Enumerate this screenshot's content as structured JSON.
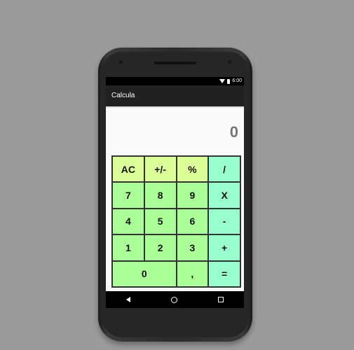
{
  "statusbar": {
    "time": "6:00",
    "wifi_icon": "wifi-icon",
    "battery_icon": "battery-icon"
  },
  "app": {
    "title": "Calcula"
  },
  "display": {
    "value": "0"
  },
  "keypad": {
    "keys": [
      {
        "label": "AC",
        "type": "top"
      },
      {
        "label": "+/-",
        "type": "top"
      },
      {
        "label": "%",
        "type": "top"
      },
      {
        "label": "/",
        "type": "op"
      },
      {
        "label": "7",
        "type": "num"
      },
      {
        "label": "8",
        "type": "num"
      },
      {
        "label": "9",
        "type": "num"
      },
      {
        "label": "X",
        "type": "op"
      },
      {
        "label": "4",
        "type": "num"
      },
      {
        "label": "5",
        "type": "num"
      },
      {
        "label": "6",
        "type": "num"
      },
      {
        "label": "-",
        "type": "op"
      },
      {
        "label": "1",
        "type": "num"
      },
      {
        "label": "2",
        "type": "num"
      },
      {
        "label": "3",
        "type": "num"
      },
      {
        "label": "+",
        "type": "op"
      },
      {
        "label": "0",
        "type": "num"
      },
      {
        "label": ",",
        "type": "num"
      },
      {
        "label": "=",
        "type": "op"
      }
    ]
  },
  "navbar": {
    "back_icon": "back-icon",
    "home_icon": "home-icon",
    "recents_icon": "recents-icon"
  },
  "colors": {
    "top_keys": "#ddff99",
    "number_keys": "#aaff99",
    "operator_keys": "#99ffcc",
    "appbar": "#212121",
    "display_text": "#757575"
  }
}
